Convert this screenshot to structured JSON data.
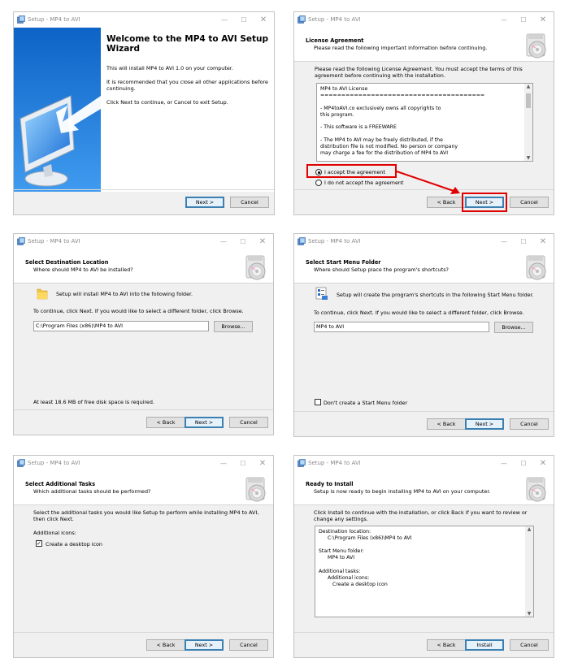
{
  "colors": {
    "highlight": "#e10000",
    "default_button_border": "#3c7fb1",
    "header_bg": "#ffffff",
    "dialog_bg": "#f0f0f0"
  },
  "window_title": "Setup - MP4 to AVI",
  "title_controls": {
    "minimize": "—",
    "maximize": "☐",
    "close": "✕"
  },
  "icons": {
    "app": "setup-app-icon",
    "disc": "cd-disc-icon",
    "folder": "folder-icon",
    "monitor": "monitor-arrow-graphic",
    "shortcuts": "start-menu-icon"
  },
  "buttons": {
    "back": "< Back",
    "next": "Next >",
    "cancel": "Cancel",
    "install": "Install",
    "browse": "Browse..."
  },
  "welcome": {
    "heading": "Welcome to the MP4 to AVI Setup Wizard",
    "p1": "This will install MP4 to AVI 1.0 on your computer.",
    "p2": "It is recommended that you close all other applications before continuing.",
    "p3": "Click Next to continue, or Cancel to exit Setup."
  },
  "license": {
    "title": "License Agreement",
    "subtitle": "Please read the following important information before continuing.",
    "intro": "Please read the following License Agreement. You must accept the terms of this agreement before continuing with the installation.",
    "lines": [
      "MP4 to AVI License",
      "=======================================",
      "",
      "- MP4toAVI.co exclusively owns all copyrights to",
      "this program.",
      "",
      "- This software is a FREEWARE",
      "",
      "- The MP4 to AVI may be freely distributed, if the",
      "distribution file is not modified. No person or company",
      "may charge a fee for the distribution of MP4 to AVI"
    ],
    "accept": "I accept the agreement",
    "decline": "I do not accept the agreement"
  },
  "destination": {
    "title": "Select Destination Location",
    "subtitle": "Where should MP4 to AVI be installed?",
    "info": "Setup will install MP4 to AVI into the following folder.",
    "instruction": "To continue, click Next. If you would like to select a different folder, click Browse.",
    "path": "C:\\Program Files (x86)\\MP4 to AVI",
    "space": "At least 18.6 MB of free disk space is required."
  },
  "startmenu": {
    "title": "Select Start Menu Folder",
    "subtitle": "Where should Setup place the program's shortcuts?",
    "info": "Setup will create the program's shortcuts in the following Start Menu folder.",
    "instruction": "To continue, click Next. If you would like to select a different folder, click Browse.",
    "folder": "MP4 to AVI",
    "no_folder": "Don't create a Start Menu folder"
  },
  "tasks": {
    "title": "Select Additional Tasks",
    "subtitle": "Which additional tasks should be performed?",
    "intro": "Select the additional tasks you would like Setup to perform while installing MP4 to AVI, then click Next.",
    "group": "Additional icons:",
    "desktop": "Create a desktop icon"
  },
  "ready": {
    "title": "Ready to Install",
    "subtitle": "Setup is now ready to begin installing MP4 to AVI on your computer.",
    "intro": "Click Install to continue with the installation, or click Back if you want to review or change any settings.",
    "summary": [
      "Destination location:",
      "C:\\Program Files (x86)\\MP4 to AVI",
      "",
      "Start Menu folder:",
      "MP4 to AVI",
      "",
      "Additional tasks:",
      "Additional icons:",
      "Create a desktop icon"
    ]
  }
}
